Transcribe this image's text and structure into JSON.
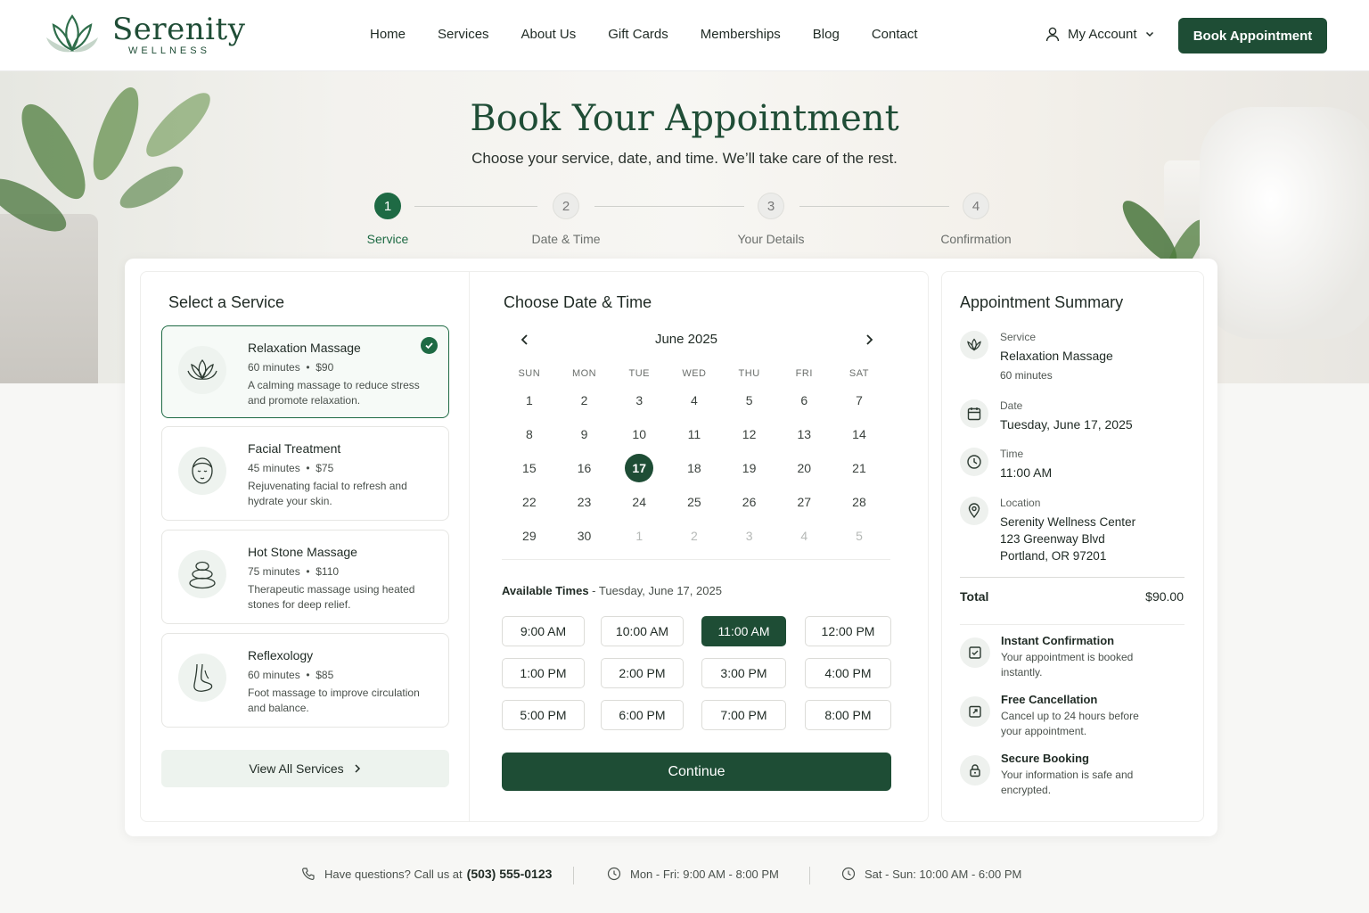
{
  "brand": {
    "name": "Serenity",
    "tagline": "WELLNESS"
  },
  "nav": {
    "items": [
      "Home",
      "Services",
      "About Us",
      "Gift Cards",
      "Memberships",
      "Blog",
      "Contact"
    ],
    "account_label": "My Account",
    "book_button": "Book Appointment"
  },
  "hero": {
    "title": "Book Your Appointment",
    "subtitle": "Choose your service, date, and time. We’ll take care of the rest."
  },
  "steps": [
    {
      "number": "1",
      "label": "Service",
      "active": true
    },
    {
      "number": "2",
      "label": "Date & Time",
      "active": false
    },
    {
      "number": "3",
      "label": "Your Details",
      "active": false
    },
    {
      "number": "4",
      "label": "Confirmation",
      "active": false
    }
  ],
  "services": {
    "title": "Select a Service",
    "items": [
      {
        "name": "Relaxation Massage",
        "duration": "60 minutes",
        "price": "$90",
        "description": "A calming massage to reduce stress and promote relaxation.",
        "icon": "lotus-icon",
        "selected": true
      },
      {
        "name": "Facial Treatment",
        "duration": "45 minutes",
        "price": "$75",
        "description": "Rejuvenating facial to refresh and hydrate your skin.",
        "icon": "face-icon",
        "selected": false
      },
      {
        "name": "Hot Stone Massage",
        "duration": "75 minutes",
        "price": "$110",
        "description": "Therapeutic massage using heated stones for deep relief.",
        "icon": "stones-icon",
        "selected": false
      },
      {
        "name": "Reflexology",
        "duration": "60 minutes",
        "price": "$85",
        "description": "Foot massage to improve circulation and balance.",
        "icon": "foot-icon",
        "selected": false
      }
    ],
    "view_all": "View All Services"
  },
  "calendar": {
    "title": "Choose Date & Time",
    "month": "June 2025",
    "weekdays": [
      "SUN",
      "MON",
      "TUE",
      "WED",
      "THU",
      "FRI",
      "SAT"
    ],
    "weeks": [
      [
        {
          "d": "1"
        },
        {
          "d": "2"
        },
        {
          "d": "3"
        },
        {
          "d": "4"
        },
        {
          "d": "5"
        },
        {
          "d": "6"
        },
        {
          "d": "7"
        }
      ],
      [
        {
          "d": "8"
        },
        {
          "d": "9"
        },
        {
          "d": "10"
        },
        {
          "d": "11"
        },
        {
          "d": "12"
        },
        {
          "d": "13"
        },
        {
          "d": "14"
        }
      ],
      [
        {
          "d": "15"
        },
        {
          "d": "16"
        },
        {
          "d": "17",
          "selected": true
        },
        {
          "d": "18"
        },
        {
          "d": "19"
        },
        {
          "d": "20"
        },
        {
          "d": "21"
        }
      ],
      [
        {
          "d": "22"
        },
        {
          "d": "23"
        },
        {
          "d": "24"
        },
        {
          "d": "25"
        },
        {
          "d": "26"
        },
        {
          "d": "27"
        },
        {
          "d": "28"
        }
      ],
      [
        {
          "d": "29"
        },
        {
          "d": "30"
        },
        {
          "d": "1",
          "muted": true
        },
        {
          "d": "2",
          "muted": true
        },
        {
          "d": "3",
          "muted": true
        },
        {
          "d": "4",
          "muted": true
        },
        {
          "d": "5",
          "muted": true
        }
      ]
    ],
    "available_label": "Available Times",
    "available_date": "Tuesday, June 17, 2025",
    "times": [
      "9:00 AM",
      "10:00 AM",
      "11:00 AM",
      "12:00 PM",
      "1:00 PM",
      "2:00 PM",
      "3:00 PM",
      "4:00 PM",
      "5:00 PM",
      "6:00 PM",
      "7:00 PM",
      "8:00 PM"
    ],
    "selected_time": "11:00 AM",
    "continue": "Continue"
  },
  "summary": {
    "title": "Appointment Summary",
    "service_label": "Service",
    "service_value": "Relaxation Massage",
    "service_duration": "60 minutes",
    "date_label": "Date",
    "date_value": "Tuesday, June 17, 2025",
    "time_label": "Time",
    "time_value": "11:00 AM",
    "location_label": "Location",
    "location_lines": [
      "Serenity Wellness Center",
      "123 Greenway Blvd",
      "Portland, OR 97201"
    ],
    "total_label": "Total",
    "total_value": "$90.00",
    "perks": [
      {
        "title": "Instant Confirmation",
        "desc": "Your appointment is booked instantly.",
        "icon": "check-square-icon"
      },
      {
        "title": "Free Cancellation",
        "desc": "Cancel up to 24 hours before your appointment.",
        "icon": "calendar-refresh-icon"
      },
      {
        "title": "Secure Booking",
        "desc": "Your information is safe and encrypted.",
        "icon": "lock-icon"
      }
    ]
  },
  "footer": {
    "phone_text": "Have questions? Call us at",
    "phone_number": "(503) 555-0123",
    "weekday_hours": "Mon - Fri: 9:00 AM - 8:00 PM",
    "weekend_hours": "Sat - Sun: 10:00 AM - 6:00 PM"
  },
  "colors": {
    "accent": "#1e4d35",
    "accent_light": "#1e6a44",
    "muted_bg": "#edf3ee"
  }
}
